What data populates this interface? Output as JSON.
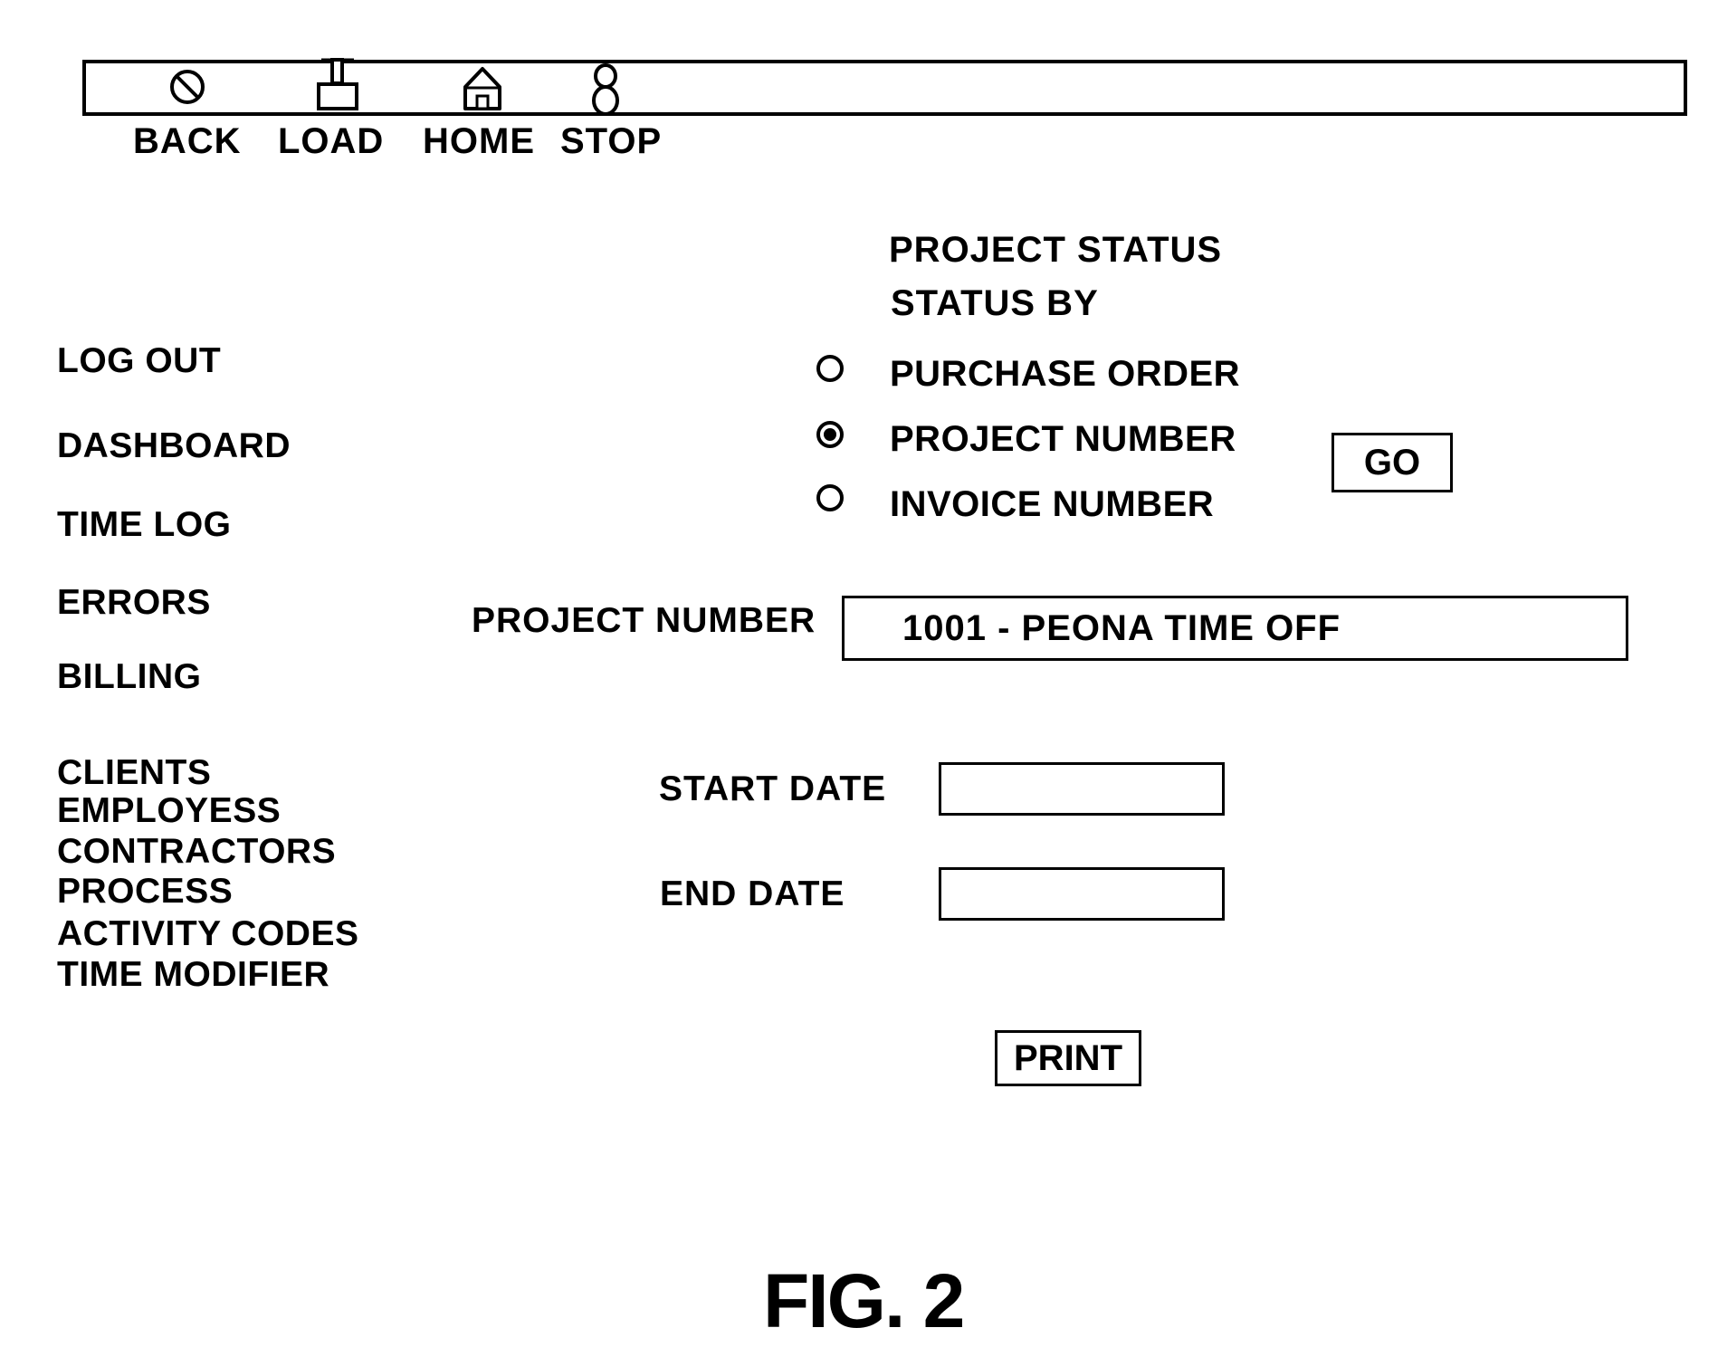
{
  "toolbar": {
    "buttons": [
      {
        "label": "BACK",
        "icon": "back-icon"
      },
      {
        "label": "LOAD",
        "icon": "load-icon"
      },
      {
        "label": "HOME",
        "icon": "home-icon"
      },
      {
        "label": "STOP",
        "icon": "stop-icon"
      }
    ]
  },
  "sidebar": {
    "primary": [
      "LOG OUT",
      "DASHBOARD",
      "TIME LOG",
      "ERRORS",
      "BILLING"
    ],
    "secondary": [
      "CLIENTS",
      "EMPLOYESS",
      "CONTRACTORS",
      "PROCESS",
      "ACTIVITY CODES",
      "TIME MODIFIER"
    ]
  },
  "main": {
    "title": "PROJECT STATUS",
    "status_by_label": "STATUS BY",
    "status_options": [
      {
        "label": "PURCHASE ORDER",
        "selected": false
      },
      {
        "label": "PROJECT NUMBER",
        "selected": true
      },
      {
        "label": "INVOICE NUMBER",
        "selected": false
      }
    ],
    "go_label": "GO",
    "project_number_label": "PROJECT NUMBER",
    "project_number_value": "1001 - PEONA TIME OFF",
    "start_date_label": "START DATE",
    "start_date_value": "",
    "end_date_label": "END DATE",
    "end_date_value": "",
    "print_label": "PRINT"
  },
  "figure_caption": "FIG. 2"
}
